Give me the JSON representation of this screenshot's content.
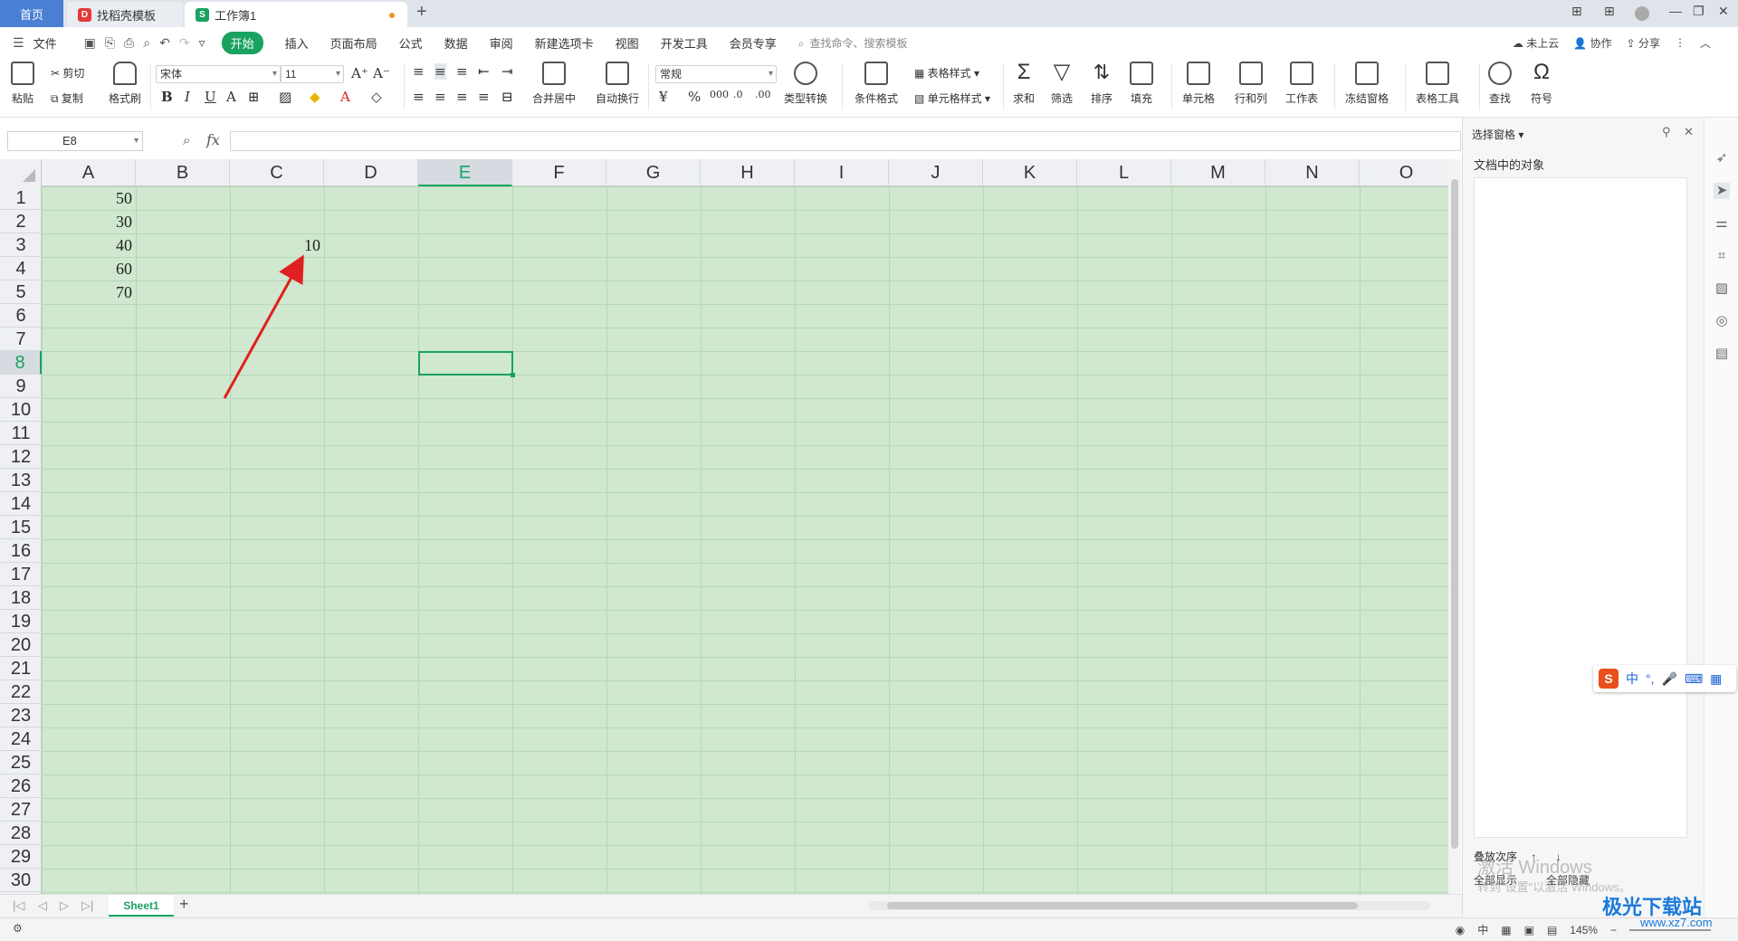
{
  "tabs": {
    "home": "首页",
    "template": "找稻壳模板",
    "workbook": "工作簿1",
    "add": "+"
  },
  "window_controls": {
    "layout": "⊞",
    "grid": "⊞",
    "minimize": "—",
    "restore": "❐",
    "close": "✕"
  },
  "menu": {
    "file": "文件",
    "items": [
      "开始",
      "插入",
      "页面布局",
      "公式",
      "数据",
      "审阅",
      "新建选项卡",
      "视图",
      "开发工具",
      "会员专享"
    ],
    "active_index": 0,
    "search_placeholder": "查找命令、搜索模板",
    "cloud": "未上云",
    "collab": "协作",
    "share": "分享"
  },
  "ribbon": {
    "paste": "粘贴",
    "cut": "剪切",
    "copy": "复制",
    "format_painter": "格式刷",
    "font_name": "宋体",
    "font_size": "11",
    "merge_center": "合并居中",
    "wrap_text": "自动换行",
    "number_format": "常规",
    "type_convert": "类型转换",
    "conditional_format": "条件格式",
    "table_style": "表格样式",
    "cell_style": "单元格样式",
    "sum": "求和",
    "filter": "筛选",
    "sort": "排序",
    "fill": "填充",
    "cell": "单元格",
    "row_col": "行和列",
    "worksheet": "工作表",
    "freeze": "冻结窗格",
    "table_tools": "表格工具",
    "find": "查找",
    "symbol": "符号"
  },
  "formula_bar": {
    "name_box": "E8",
    "fx": "fx",
    "value": ""
  },
  "columns": [
    "A",
    "B",
    "C",
    "D",
    "E",
    "F",
    "G",
    "H",
    "I",
    "J",
    "K",
    "L",
    "M",
    "N",
    "O"
  ],
  "selected_column": "E",
  "rows": [
    "1",
    "2",
    "3",
    "4",
    "5",
    "6",
    "7",
    "8",
    "9",
    "10",
    "11",
    "12",
    "13",
    "14",
    "15",
    "16",
    "17",
    "18",
    "19",
    "20",
    "21",
    "22",
    "23",
    "24",
    "25",
    "26",
    "27",
    "28",
    "29",
    "30"
  ],
  "selected_row": "8",
  "cells": {
    "A1": "50",
    "A2": "30",
    "A3": "40",
    "A4": "60",
    "A5": "70",
    "C3": "10"
  },
  "sheets": {
    "active": "Sheet1",
    "add": "+"
  },
  "status": {
    "zoom": "145%",
    "ime": "中"
  },
  "pane": {
    "title": "选择窗格",
    "subtitle": "文档中的对象",
    "order": "叠放次序",
    "show_all": "全部显示",
    "hide_all": "全部隐藏"
  },
  "watermark": {
    "line1": "激活 Windows",
    "line2": "转到\"设置\"以激活 Windows。"
  },
  "ime_bar": {
    "logo": "S",
    "mode": "中"
  },
  "site_badge": {
    "name": "极光下载站",
    "url": "www.xz7.com"
  },
  "annotation_color": "#e02020",
  "accent": "#1aa260"
}
